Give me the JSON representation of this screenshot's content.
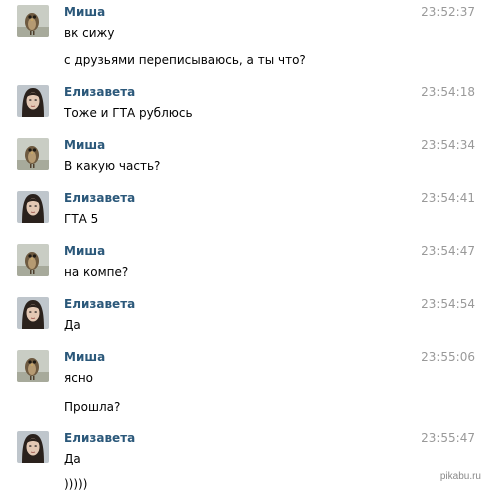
{
  "chat": {
    "messages": [
      {
        "author": "Миша",
        "avatar": "owl-avatar-icon",
        "time": "23:52:37",
        "lines": [
          "вк сижу",
          "с друзьями переписываюсь, а ты что?"
        ]
      },
      {
        "author": "Елизавета",
        "avatar": "girl-avatar-icon",
        "time": "23:54:18",
        "lines": [
          "Тоже и ГТА рублюсь"
        ]
      },
      {
        "author": "Миша",
        "avatar": "owl-avatar-icon",
        "time": "23:54:34",
        "lines": [
          "В какую часть?"
        ]
      },
      {
        "author": "Елизавета",
        "avatar": "girl-avatar-icon",
        "time": "23:54:41",
        "lines": [
          "ГТА 5"
        ]
      },
      {
        "author": "Миша",
        "avatar": "owl-avatar-icon",
        "time": "23:54:47",
        "lines": [
          "на компе?"
        ]
      },
      {
        "author": "Елизавета",
        "avatar": "girl-avatar-icon",
        "time": "23:54:54",
        "lines": [
          "Да"
        ]
      },
      {
        "author": "Миша",
        "avatar": "owl-avatar-icon",
        "time": "23:55:06",
        "lines": [
          "ясно",
          "Прошла?"
        ]
      },
      {
        "author": "Елизавета",
        "avatar": "girl-avatar-icon",
        "time": "23:55:47",
        "lines": [
          "Да",
          ")))))"
        ]
      }
    ]
  },
  "watermark": "pikabu.ru",
  "colors": {
    "name": "#2b587a",
    "time": "#999999",
    "text": "#000000"
  }
}
